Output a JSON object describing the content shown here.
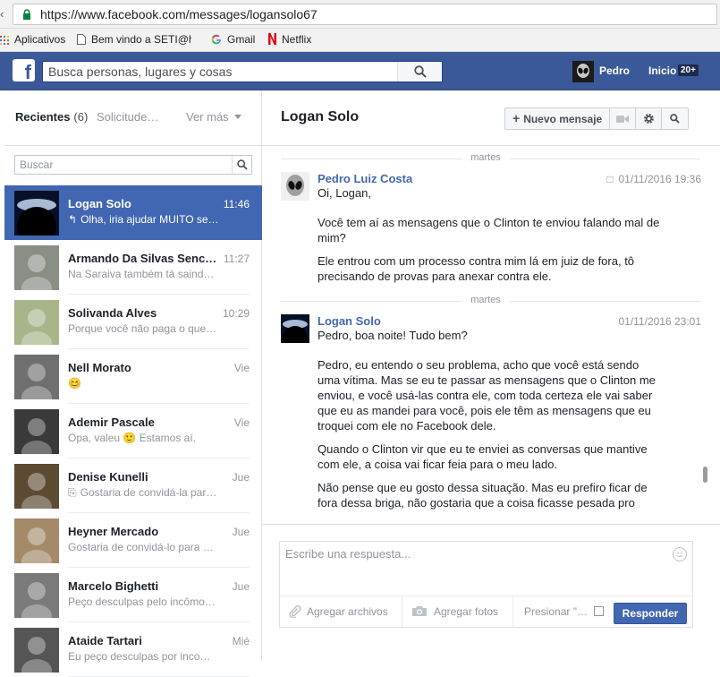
{
  "browser": {
    "url": "https://www.facebook.com/messages/logansolo67",
    "bookmarks": [
      {
        "label": "Aplicativos",
        "icon": "apps-grid-icon"
      },
      {
        "label": "Bem vindo a SETI@ho",
        "icon": "page-icon"
      },
      {
        "label": "Gmail",
        "icon": "google-g-icon"
      },
      {
        "label": "Netflix",
        "icon": "netflix-n-icon"
      }
    ]
  },
  "topbar": {
    "logo": "f",
    "search_placeholder": "Busca personas, lugares y cosas",
    "profile_name": "Pedro",
    "home_label": "Inicio",
    "home_badge": "20+"
  },
  "sidebar": {
    "tab_recent": "Recientes",
    "tab_recent_count": "(6)",
    "tab_requests": "Solicitude…",
    "tab_more": "Ver más",
    "search_placeholder": "Buscar",
    "threads": [
      {
        "name": "Logan Solo",
        "time": "11:46",
        "snippet": "Olha, iria ajudar MUITO se…",
        "snippet_icon": "reply-arrow-icon",
        "active": true,
        "avatar_color": "#0b1a3a"
      },
      {
        "name": "Armando Da Silvas Senc…",
        "time": "11:27",
        "snippet": "Na Saraiva também tá saind…",
        "snippet_icon": "",
        "active": false,
        "avatar_color": "#8a8f86"
      },
      {
        "name": "Solivanda Alves",
        "time": "10:29",
        "snippet": "Porque você não paga o que…",
        "snippet_icon": "",
        "active": false,
        "avatar_color": "#a8b58a"
      },
      {
        "name": "Nell Morato",
        "time": "Vie",
        "snippet": "😊",
        "snippet_icon": "",
        "active": false,
        "avatar_color": "#6f6f6f"
      },
      {
        "name": "Ademir Pascale",
        "time": "Vie",
        "snippet": "Opa, valeu 🙂 Estamos aí.",
        "snippet_icon": "",
        "active": false,
        "avatar_color": "#3a3a3a"
      },
      {
        "name": "Denise Kunelli",
        "time": "Jue",
        "snippet": "Gostaria de convidá-la par…",
        "snippet_icon": "attach-clip-icon",
        "active": false,
        "avatar_color": "#5c4a33"
      },
      {
        "name": "Heyner Mercado",
        "time": "Jue",
        "snippet": "Gostaria de convidá-lo para …",
        "snippet_icon": "",
        "active": false,
        "avatar_color": "#a58a6a"
      },
      {
        "name": "Marcelo Bighetti",
        "time": "Jue",
        "snippet": "Peço desculpas pelo incômo…",
        "snippet_icon": "",
        "active": false,
        "avatar_color": "#7a7a7a"
      },
      {
        "name": "Ataide Tartari",
        "time": "Mié",
        "snippet": "Eu peço desculpas por inco…",
        "snippet_icon": "",
        "active": false,
        "avatar_color": "#555555"
      }
    ]
  },
  "conversation": {
    "title": "Logan Solo",
    "new_message_label": "Nuevo mensaje",
    "messages": [
      {
        "day": "martes",
        "sender": "Pedro Luiz Costa",
        "time": "01/11/2016 19:36",
        "show_time_icon": true,
        "paragraphs": [
          "Oi, Logan,",
          "Você tem aí as mensagens que o Clinton te enviou falando mal de mim?",
          "Ele entrou com um processo contra mim lá em juiz de fora, tô precisando de provas para anexar contra ele."
        ]
      },
      {
        "day": "martes",
        "sender": "Logan Solo",
        "time": "01/11/2016 23:01",
        "show_time_icon": false,
        "paragraphs": [
          "Pedro, boa noite! Tudo bem?",
          "Pedro, eu entendo o seu problema, acho que você está sendo uma vítima. Mas se eu te passar as mensagens que o Clinton me enviou, e você usá-las contra ele, com toda certeza ele vai saber que eu as mandei para você, pois ele têm as mensagens que eu troquei com ele no Facebook dele.",
          "Quando o Clinton vir que eu te enviei as conversas que mantive com ele, a coisa vai ficar feia para o meu lado.",
          "Não pense que eu gosto dessa situação. Mas eu prefiro ficar de fora dessa briga, não gostaria que a coisa ficasse pesada pro"
        ]
      }
    ]
  },
  "composer": {
    "placeholder": "Escribe una respuesta...",
    "attach_files": "Agregar archivos",
    "attach_photos": "Agregar fotos",
    "press_enter": "Presionar \"…",
    "reply_button": "Responder"
  },
  "colors": {
    "fb_blue": "#3b5998",
    "active_thread": "#4267b2",
    "sender_link": "#4267b2"
  }
}
